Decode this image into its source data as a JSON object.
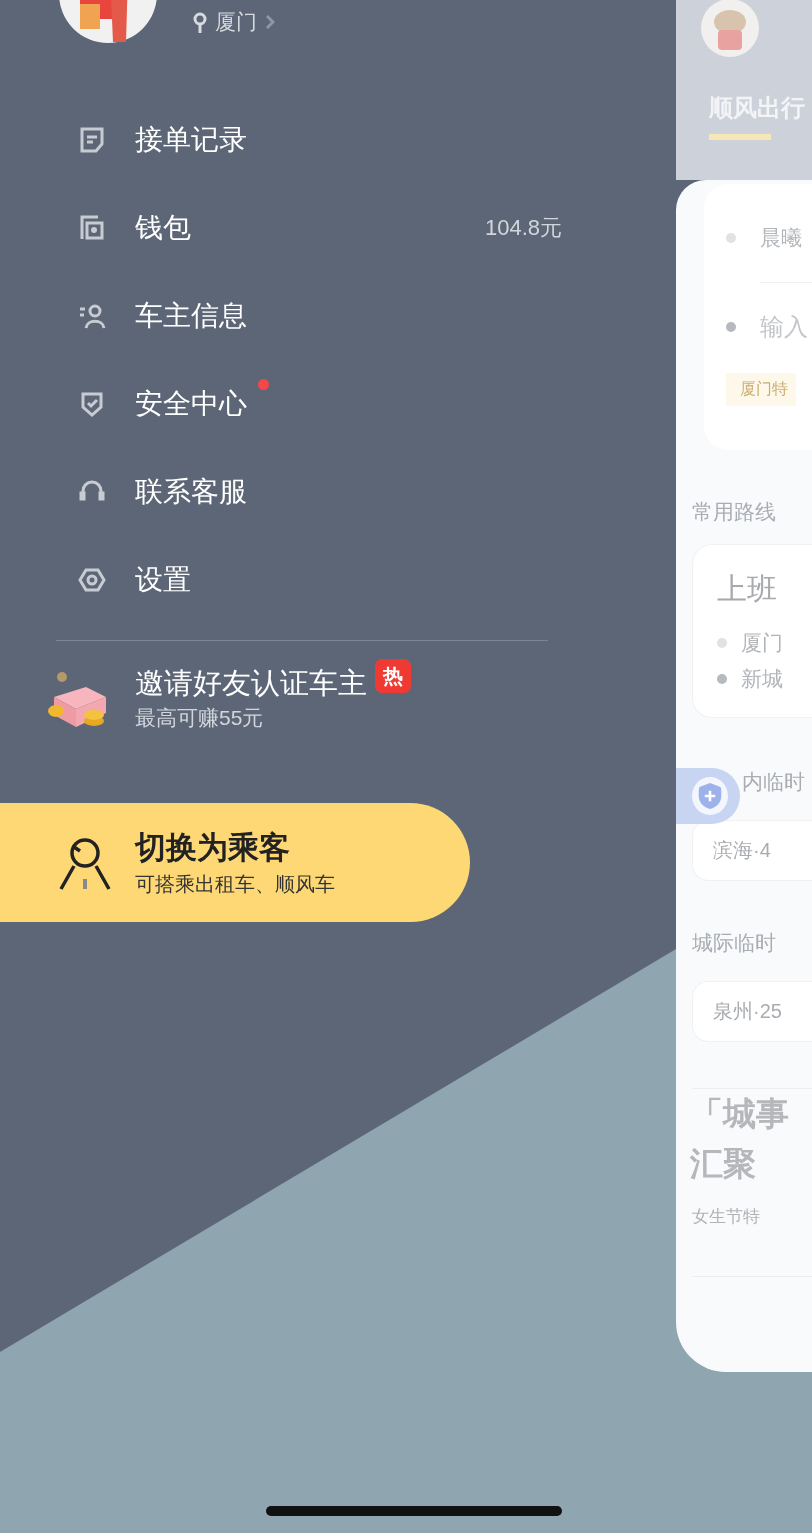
{
  "profile": {
    "location": "厦门"
  },
  "menu": [
    {
      "label": "接单记录",
      "dot": false
    },
    {
      "label": "钱包",
      "value": "104.8元",
      "dot": false
    },
    {
      "label": "车主信息",
      "dot": false
    },
    {
      "label": "安全中心",
      "dot": true
    },
    {
      "label": "联系客服",
      "dot": false
    },
    {
      "label": "设置",
      "dot": false
    }
  ],
  "invite": {
    "title": "邀请好友认证车主",
    "subtitle": "最高可赚55元",
    "badge": "热"
  },
  "switch_role": {
    "title": "切换为乘客",
    "subtitle": "可搭乘出租车、顺风车"
  },
  "background_page": {
    "tab": {
      "label": "顺风出行",
      "selected": true
    },
    "trip_card": {
      "start": "晨曦",
      "destination_placeholder": "输入",
      "tag": "厦门特"
    },
    "common_routes": {
      "title": "常用路线",
      "route": {
        "name": "上班",
        "from": "厦门",
        "to": "新城"
      }
    },
    "city_temporary": {
      "title": "内临时",
      "route": "滨海·4"
    },
    "intercity_temporary": {
      "title": "城际临时",
      "route": "泉州·25"
    },
    "article": {
      "lines": [
        "「城事",
        "汇聚"
      ],
      "subtitle": "女生节特"
    }
  }
}
